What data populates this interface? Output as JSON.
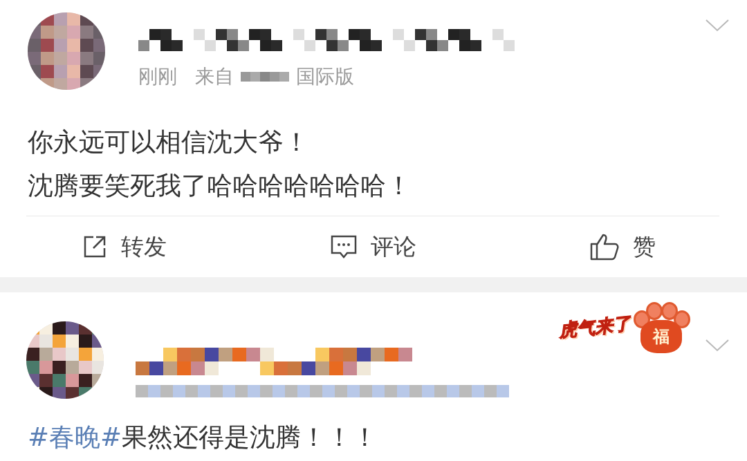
{
  "posts": [
    {
      "kind": "plain",
      "meta": {
        "time": "刚刚",
        "source_prefix": "来自",
        "source_suffix": "国际版"
      },
      "lines": [
        "你永远可以相信沈大爷！",
        "沈腾要笑死我了哈哈哈哈哈哈哈！"
      ],
      "actions": [
        {
          "kind": "repost",
          "label": "转发"
        },
        {
          "kind": "comment",
          "label": "评论"
        },
        {
          "kind": "like",
          "label": "赞"
        }
      ]
    },
    {
      "kind": "badge",
      "badge": {
        "text": "虎气来了",
        "paw_text": "福"
      },
      "hashtag": "#春晚#",
      "rest": "果然还得是沈腾！！！"
    }
  ]
}
